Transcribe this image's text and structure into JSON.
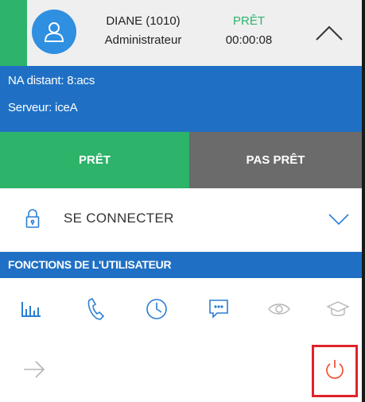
{
  "colors": {
    "accent_blue": "#1f70c4",
    "ready_green": "#2db36a",
    "not_ready_gray": "#6b6b6b",
    "icon_blue": "#2a7fd4",
    "icon_gray": "#b5b5b5",
    "logout_red": "#f05a3c",
    "highlight_red": "#e0222a"
  },
  "header": {
    "user_name": "DIANE (1010)",
    "user_role": "Administrateur",
    "status": "PRÊT",
    "timer": "00:00:08",
    "avatar_icon": "user-icon",
    "collapse_icon": "chevron-up-icon"
  },
  "info": {
    "remote_na": "NA distant: 8:acs",
    "server": "Serveur: iceA"
  },
  "state_buttons": {
    "ready": "PRÊT",
    "not_ready": "PAS PRÊT"
  },
  "connect": {
    "label": "SE CONNECTER",
    "icon": "lock-icon",
    "expand_icon": "chevron-down-icon"
  },
  "user_functions": {
    "title": "FONCTIONS DE L'UTILISATEUR",
    "icons": [
      {
        "name": "statistics-icon",
        "enabled": true
      },
      {
        "name": "phone-icon",
        "enabled": true
      },
      {
        "name": "clock-icon",
        "enabled": true
      },
      {
        "name": "chat-icon",
        "enabled": true
      },
      {
        "name": "eye-icon",
        "enabled": false
      },
      {
        "name": "graduation-cap-icon",
        "enabled": false
      }
    ]
  },
  "bottom": {
    "forward_icon": "arrow-right-icon",
    "logout_icon": "power-icon"
  }
}
